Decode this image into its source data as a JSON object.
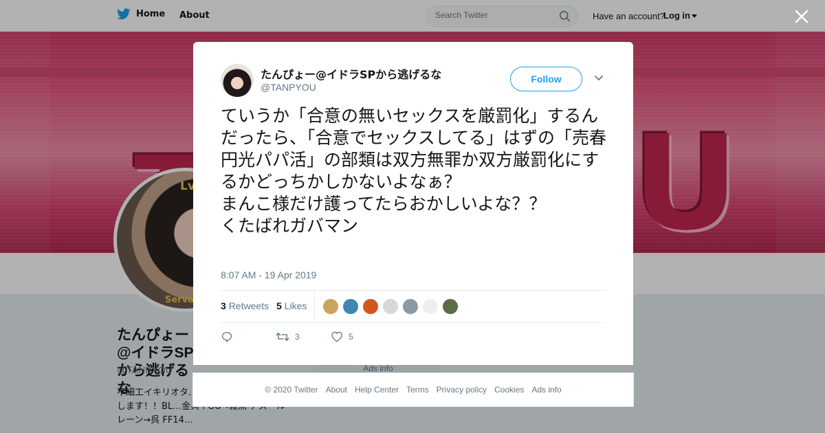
{
  "nav": {
    "home_label": "Home",
    "about_label": "About",
    "search_placeholder": "Search Twitter",
    "have_account": "Have an account?",
    "login_label": "Log in"
  },
  "profile": {
    "name": "たんぴょー@イドラSPから逃げるな",
    "handle": "@TANPYOU",
    "bio": "不細工イキリオタ…軽にどうぞ！フォロバします！！BL…金兵 FGO→雑魚 アズールレーン→呉 FF14…",
    "avatar_lv": "Lv",
    "avatar_caption": "Serva",
    "banner_letters": [
      "T",
      "U"
    ]
  },
  "tweet": {
    "author_name": "たんぴょー@イドラSPから逃げるな",
    "author_handle": "@TANPYOU",
    "follow_label": "Follow",
    "text": "ていうか「合意の無いセックスを厳罰化」するんだったら、「合意でセックスしてる」はずの「売春円光パパ活」の部類は双方無罪か双方厳罰化にするかどっちかしかないよなぁ？\nまんこ様だけ護ってたらおかしいよな？？\nくたばれガバマン",
    "timestamp": "8:07 AM - 19 Apr 2019",
    "retweets_count": "3",
    "retweets_label": "Retweets",
    "likes_count": "5",
    "likes_label": "Likes",
    "liker_colors": [
      "#c9a45c",
      "#3f86b0",
      "#d3561f",
      "#d8d8d8",
      "#8a99a6",
      "#eeeeee",
      "#5c6b4a"
    ],
    "action_retweets": "3",
    "action_likes": "5"
  },
  "ads_info": "Ads info",
  "footer": {
    "copyright": "© 2020 Twitter",
    "about": "About",
    "help_center": "Help Center",
    "terms": "Terms",
    "privacy": "Privacy policy",
    "cookies": "Cookies",
    "ads_info": "Ads info"
  },
  "colors": {
    "twitter_blue": "#1da1f2",
    "text_primary": "#14171a",
    "text_secondary": "#657786"
  },
  "icons": [
    "twitter-bird-icon",
    "search-icon",
    "close-icon",
    "chevron-down-icon",
    "reply-icon",
    "retweet-icon",
    "heart-icon"
  ]
}
